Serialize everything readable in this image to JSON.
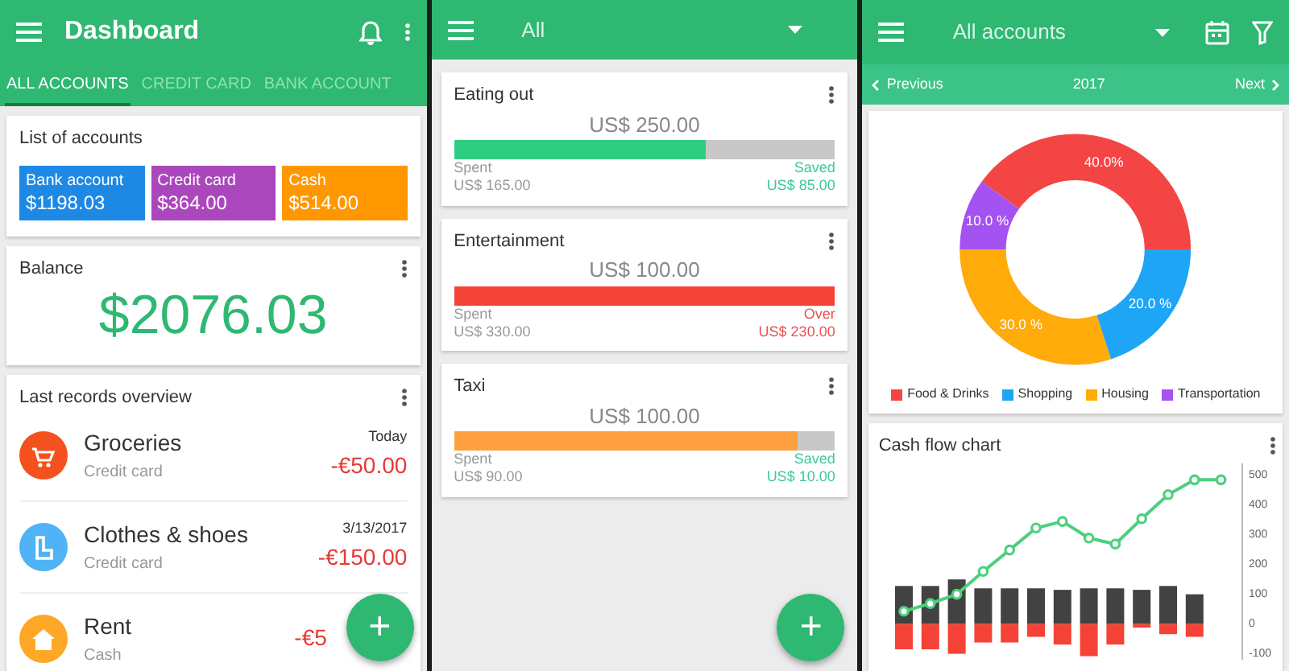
{
  "dashboard": {
    "title": "Dashboard",
    "tabs": [
      {
        "label": "ALL ACCOUNTS",
        "selected": true
      },
      {
        "label": "CREDIT CARD",
        "selected": false
      },
      {
        "label": "BANK ACCOUNT",
        "selected": false
      }
    ],
    "accounts_card": {
      "title": "List of accounts",
      "accounts": [
        {
          "name": "Bank account",
          "amount": "$1198.03",
          "color": "#1e88e5"
        },
        {
          "name": "Credit card",
          "amount": "$364.00",
          "color": "#ab47bc"
        },
        {
          "name": "Cash",
          "amount": "$514.00",
          "color": "#ff9800"
        }
      ]
    },
    "balance_card": {
      "title": "Balance",
      "amount": "$2076.03"
    },
    "records_card": {
      "title": "Last records overview",
      "records": [
        {
          "kind": "cart",
          "name": "Groceries",
          "account": "Credit card",
          "date": "Today",
          "amount": "-€50.00",
          "color": "#f4511e"
        },
        {
          "kind": "boot",
          "name": "Clothes & shoes",
          "account": "Credit card",
          "date": "3/13/2017",
          "amount": "-€150.00",
          "color": "#4fb3f6"
        },
        {
          "kind": "house",
          "name": "Rent",
          "account": "Cash",
          "amount": "-€5",
          "color": "#ffa726"
        }
      ]
    },
    "fab": "+"
  },
  "budgets": {
    "filter": "All",
    "items": [
      {
        "name": "Eating out",
        "limit": "US$ 250.00",
        "level": 0.66,
        "color": "#2ecc80",
        "over": false,
        "left_label": "Spent",
        "left_amount": "US$ 165.00",
        "right_label": "Saved",
        "right_amount": "US$ 85.00"
      },
      {
        "name": "Entertainment",
        "limit": "US$ 100.00",
        "level": 1,
        "color": "#f44336",
        "over": true,
        "left_label": "Spent",
        "left_amount": "US$ 330.00",
        "right_label": "Over",
        "right_amount": "US$ 230.00"
      },
      {
        "name": "Taxi",
        "limit": "US$ 100.00",
        "level": 0.9,
        "color": "#ffa040",
        "over": false,
        "left_label": "Spent",
        "left_amount": "US$ 90.00",
        "right_label": "Saved",
        "right_amount": "US$ 10.00"
      }
    ],
    "fab": "+"
  },
  "statistics": {
    "filter": "All accounts",
    "period": {
      "previous": "Previous",
      "current": "2017",
      "next": "Next"
    },
    "donut": {
      "chart_data": {
        "type": "donut",
        "categories": [
          "Food & Drinks",
          "Shopping",
          "Housing",
          "Transportation"
        ],
        "values": [
          40,
          20,
          30,
          10
        ],
        "colors": [
          "#f44545",
          "#1ea5f5",
          "#ffab0a",
          "#a552f2"
        ],
        "value_labels": [
          "40.0%",
          "20.0 %",
          "30.0 %",
          "10.0 %"
        ]
      }
    },
    "cash_flow": {
      "title": "Cash flow chart",
      "chart_data": {
        "type": "bar",
        "stacked": true,
        "series": [
          {
            "color": "#424242",
            "values": [
              128,
              128,
              150,
              120,
              120,
              120,
              115,
              120,
              120,
              115,
              128,
              100,
              null
            ]
          },
          {
            "color": "#f44336",
            "values": [
              -85,
              -85,
              -100,
              -62,
              -62,
              -43,
              -69,
              -108,
              -69,
              -12,
              -34,
              -43,
              null
            ]
          },
          {
            "type": "line",
            "marker": true,
            "color": "#4cd07d",
            "values": [
              43,
              69,
              100,
              177,
              249,
              323,
              345,
              289,
              269,
              354,
              435,
              485,
              485
            ]
          }
        ],
        "ylim": [
          -120,
          540
        ],
        "yticks": [
          500,
          400,
          300,
          200,
          100,
          0,
          -100
        ]
      }
    }
  }
}
